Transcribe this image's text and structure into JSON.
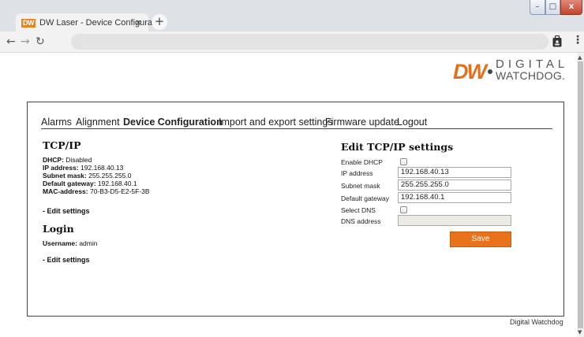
{
  "browser": {
    "tab_title": "DW Laser - Device Configuration",
    "tab_favicon_text": "DW",
    "tab_close": "×",
    "new_tab": "+",
    "address": "",
    "window_controls": {
      "minimize": "–",
      "maximize": "□",
      "close": "x"
    },
    "icons": [
      "back-arrow-icon",
      "forward-arrow-icon",
      "reload-icon",
      "profile-icon",
      "more-menu-icon"
    ]
  },
  "logo": {
    "mark": "DW",
    "line1": "DIGITAL",
    "line2": "WATCHDOG."
  },
  "nav": {
    "items": [
      {
        "label": "Alarms",
        "active": false
      },
      {
        "label": "Alignment",
        "active": false
      },
      {
        "label": "Device Configuration",
        "active": true
      },
      {
        "label": "Import and export settings",
        "active": false
      },
      {
        "label": "Firmware update",
        "active": false
      },
      {
        "label": "Logout",
        "active": false
      }
    ]
  },
  "tcpip": {
    "title": "TCP/IP",
    "rows": [
      {
        "label": "DHCP:",
        "value": "Disabled"
      },
      {
        "label": "IP address:",
        "value": "192.168.40.13"
      },
      {
        "label": "Subnet mask:",
        "value": "255.255.255.0"
      },
      {
        "label": "Default gateway:",
        "value": "192.168.40.1"
      },
      {
        "label": "MAC-address:",
        "value": "70-B3-D5-E2-5F-3B"
      }
    ],
    "edit_link": "- Edit settings"
  },
  "login": {
    "title": "Login",
    "username_label": "Username:",
    "username_value": "admin",
    "edit_link": "- Edit settings"
  },
  "edit_tcpip": {
    "title": "Edit TCP/IP settings",
    "enable_dhcp_label": "Enable DHCP",
    "enable_dhcp_checked": false,
    "ip_label": "IP address",
    "ip_value": "192.168.40.13",
    "subnet_label": "Subnet mask",
    "subnet_value": "255.255.255.0",
    "gateway_label": "Default gateway",
    "gateway_value": "192.168.40.1",
    "select_dns_label": "Select DNS",
    "select_dns_checked": false,
    "dns_label": "DNS address",
    "dns_value": "",
    "save_label": "Save"
  },
  "footer": {
    "text": "Digital Watchdog"
  },
  "colors": {
    "accent": "#e8731c",
    "nav_underline": "#3a3f78",
    "disabled_field": "#ebebe4"
  }
}
